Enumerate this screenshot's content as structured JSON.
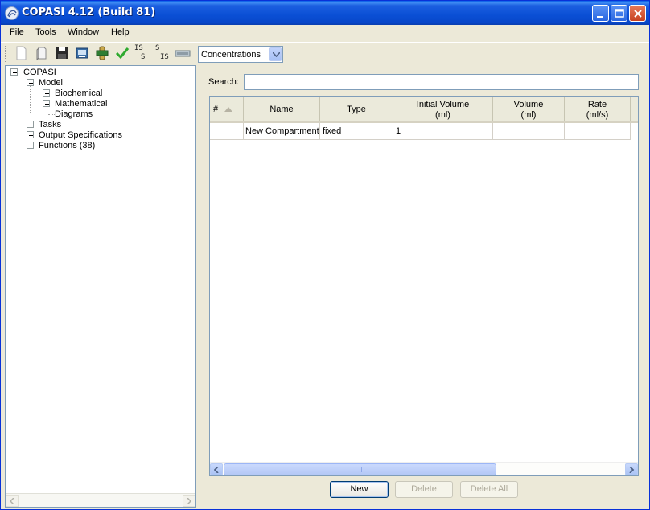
{
  "window": {
    "title": "COPASI 4.12 (Build 81)"
  },
  "menu": [
    "File",
    "Tools",
    "Window",
    "Help"
  ],
  "toolbar": {
    "icons": [
      "new-file-icon",
      "open-file-icon",
      "save-icon",
      "export-icon",
      "model-check-icon",
      "check-icon",
      "is-to-s-icon",
      "s-to-is-icon",
      "sbml-icon"
    ],
    "is_s_label_top": "IS",
    "is_s_label_bottom": "S",
    "s_is_label_top": "S",
    "s_is_label_bottom": "IS",
    "quantity_select": "Concentrations"
  },
  "tree": {
    "root": "COPASI",
    "model": "Model",
    "biochemical": "Biochemical",
    "mathematical": "Mathematical",
    "diagrams": "Diagrams",
    "tasks": "Tasks",
    "output": "Output Specifications",
    "functions": "Functions (38)"
  },
  "search": {
    "label": "Search:",
    "value": ""
  },
  "table": {
    "headers": [
      {
        "l1": "#",
        "l2": ""
      },
      {
        "l1": "Name",
        "l2": ""
      },
      {
        "l1": "Type",
        "l2": ""
      },
      {
        "l1": "Initial Volume",
        "l2": "(ml)"
      },
      {
        "l1": "Volume",
        "l2": "(ml)"
      },
      {
        "l1": "Rate",
        "l2": "(ml/s)"
      }
    ],
    "rows": [
      {
        "num": "",
        "name": "New Compartment",
        "type": "fixed",
        "initial_volume": "1",
        "volume": "",
        "rate": ""
      }
    ]
  },
  "buttons": {
    "new": "New",
    "delete": "Delete",
    "delete_all": "Delete All"
  },
  "colors": {
    "titlebar": "#0a4fd5",
    "table_border": "#7f9db9",
    "scroll_thumb": "#b4c8f6"
  }
}
